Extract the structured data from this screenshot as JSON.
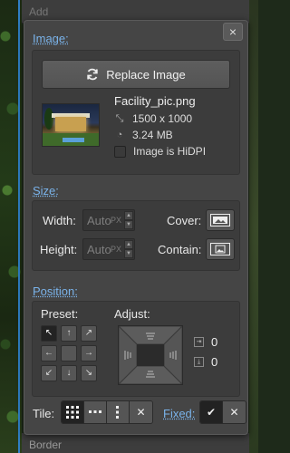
{
  "background": {
    "top_ghost": "Add",
    "bottom_ghost": "Border"
  },
  "panel": {
    "close_glyph": "×",
    "image_section": {
      "title": "Image:",
      "replace_label": "Replace Image",
      "filename": "Facility_pic.png",
      "dimensions": "1500 x 1000",
      "filesize": "3.24 MB",
      "hidpi_label": "Image is HiDPI",
      "hidpi_checked": false
    },
    "size_section": {
      "title": "Size:",
      "width_label": "Width:",
      "height_label": "Height:",
      "width_value": "Auto",
      "height_value": "Auto",
      "unit": "PX",
      "cover_label": "Cover:",
      "contain_label": "Contain:"
    },
    "position_section": {
      "title": "Position:",
      "preset_label": "Preset:",
      "adjust_label": "Adjust:",
      "preset_arrows": [
        "↖",
        "↑",
        "↗",
        "←",
        "",
        "→",
        "↙",
        "↓",
        "↘"
      ],
      "preset_selected_index": 0,
      "offset_x": "0",
      "offset_y": "0"
    },
    "footer": {
      "tile_label": "Tile:",
      "fixed_label": "Fixed:",
      "tile_selected_index": 0
    }
  },
  "colors": {
    "accent": "#7ab3ea",
    "panel_bg": "#454545",
    "selected_bg": "#222222"
  }
}
